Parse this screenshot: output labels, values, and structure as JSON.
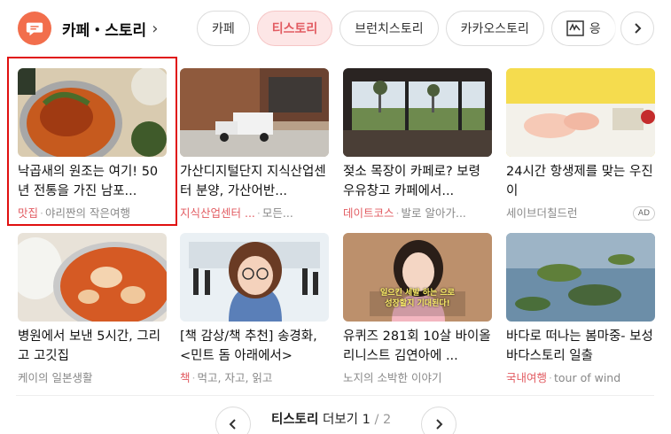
{
  "header": {
    "brand": "카페・스토리",
    "chips": [
      "카페",
      "티스토리",
      "브런치스토리",
      "카카오스토리",
      "응"
    ]
  },
  "cards": [
    {
      "title": "낙곱새의 원조는 여기! 50년 전통을 가진 남포...",
      "category": "맛집",
      "source": "야리짠의 작은여행"
    },
    {
      "title": "가산디지털단지 지식산업센터 분양, 가산어반...",
      "category": "지식산업센터 ...",
      "source": "모든..."
    },
    {
      "title": "젖소 목장이 카페로? 보령 우유창고 카페에서...",
      "category": "데이트코스",
      "source": "발로 알아가..."
    },
    {
      "title": "24시간 항생제를 맞는 우진이",
      "category": "",
      "source": "세이브더칠드런",
      "ad": "AD"
    },
    {
      "title": "병원에서 보낸 5시간, 그리고 고깃집",
      "category": "",
      "source": "케이의 일본생활"
    },
    {
      "title": "[책 감상/책 추천] 송경화, <민트 돔 아래에서>",
      "category": "책",
      "source": "먹고, 자고, 읽고"
    },
    {
      "title": "유퀴즈 281회 10살 바이올리니스트 김연아에 ...",
      "category": "",
      "source": "노지의 소박한 이야기"
    },
    {
      "title": "바다로 떠나는 봄마중- 보성 바다스토리 일출",
      "category": "국내여행",
      "source": "tour of wind"
    }
  ],
  "thumb_text": {
    "caption": "일으킨 세발 하는 으로\n성장할지 기대된다!"
  },
  "pager": {
    "label": "티스토리",
    "more": "더보기",
    "current": "1",
    "sep": "/",
    "total": "2"
  },
  "colors": {
    "accent": "#e25c62",
    "logo": "#f26e4c",
    "highlight": "#e01010"
  }
}
